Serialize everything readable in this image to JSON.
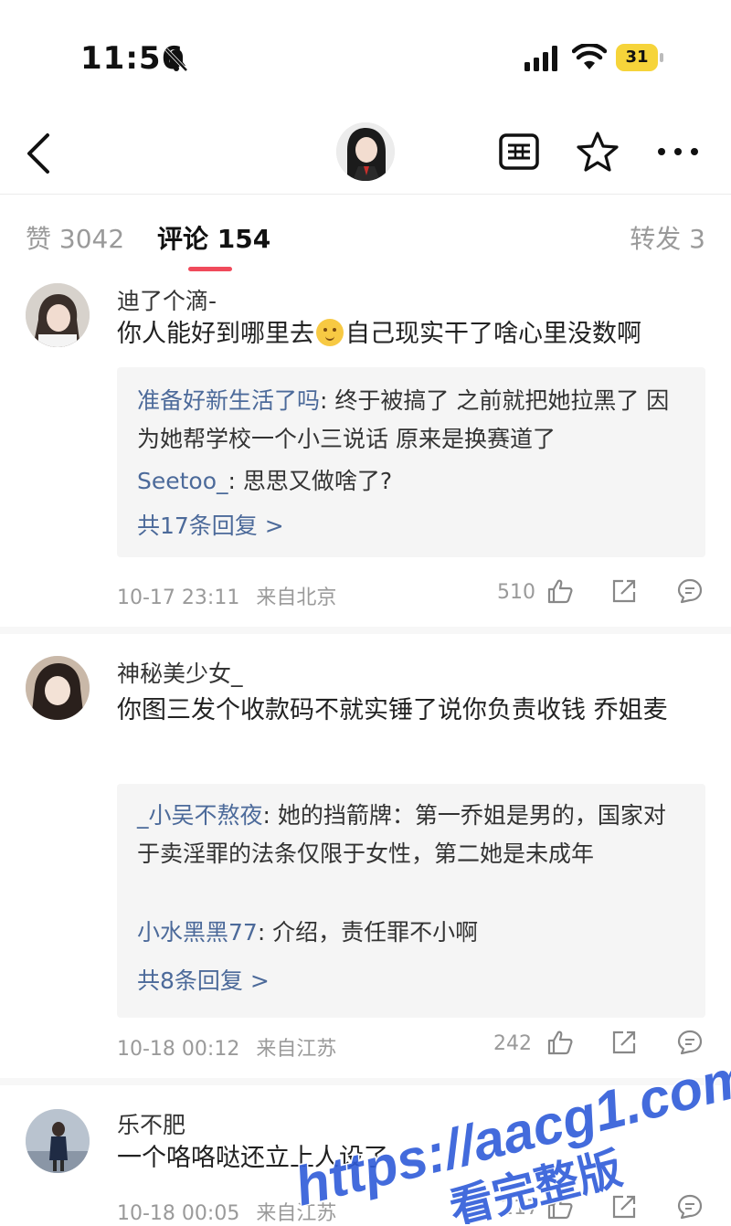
{
  "status_bar": {
    "time": "11:56",
    "battery": "31",
    "battery_color": "#f6d43a"
  },
  "nav": {
    "back_icon": "chevron-left-icon",
    "list_icon": "list-view-icon",
    "star_icon": "star-icon",
    "more_icon": "more-icon"
  },
  "tabs": {
    "likes": "赞 3042",
    "comments": "评论 154",
    "reposts": "转发 3",
    "active_color": "#f04a5b"
  },
  "comments": [
    {
      "username": "迪了个滴-",
      "content_before": "你人能好到哪里去",
      "emoji": "smile-emoji",
      "content_after": "自己现实干了啥心里没数啊",
      "replies": [
        {
          "user": "准备好新生活了吗",
          "text": ": 终于被搞了 之前就把她拉黑了 因为她帮学校一个小三说话 原来是换赛道了"
        },
        {
          "user": "Seetoo_",
          "text": ": 思思又做啥了?"
        }
      ],
      "more_replies": "共17条回复 >",
      "time": "10-17 23:11",
      "location": "来自北京",
      "likes": "510"
    },
    {
      "username": "神秘美少女_",
      "content": "你图三发个收款码不就实锤了说你负责收钱 乔姐麦",
      "replies": [
        {
          "user": "_小吴不熬夜",
          "text": ": 她的挡箭牌：第一乔姐是男的，国家对于卖淫罪的法条仅限于女性，第二她是未成年"
        },
        {
          "user": "小水黑黑77",
          "text": ": 介绍，责任罪不小啊"
        }
      ],
      "more_replies": "共8条回复 >",
      "time": "10-18 00:12",
      "location": "来自江苏",
      "likes": "242"
    },
    {
      "username": "乐不肥",
      "content": "一个咯咯哒还立上人设了",
      "time": "10-18 00:05",
      "location": "来自江苏",
      "likes": "217"
    }
  ],
  "watermark": {
    "line1": "https://aacg1.com",
    "line2": "看完整版",
    "color": "#2f5bd8"
  }
}
